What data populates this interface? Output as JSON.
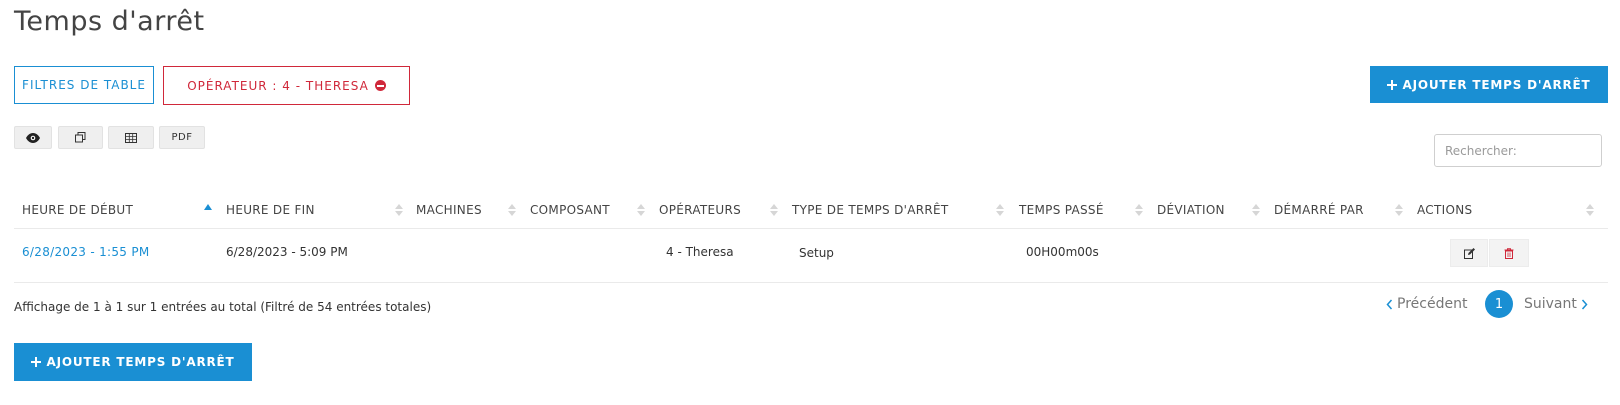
{
  "page": {
    "title": "Temps d'arrêt"
  },
  "filters": {
    "table_filters_label": "FILTRES DE TABLE",
    "active_filter_label": "OPÉRATEUR : 4 - THERESA"
  },
  "actions": {
    "add_label": "AJOUTER TEMPS D'ARRÊT"
  },
  "toolbar": {
    "pdf_label": "PDF"
  },
  "search": {
    "placeholder": "Rechercher:"
  },
  "table": {
    "columns": [
      "HEURE DE DÉBUT",
      "HEURE DE FIN",
      "MACHINES",
      "COMPOSANT",
      "OPÉRATEURS",
      "TYPE DE TEMPS D'ARRÊT",
      "TEMPS PASSÉ",
      "DÉVIATION",
      "DÉMARRÉ PAR",
      "ACTIONS"
    ],
    "sorted_column": "HEURE DE DÉBUT",
    "rows": [
      {
        "start": "6/28/2023 - 1:55 PM",
        "end": "6/28/2023 - 5:09 PM",
        "machines": "",
        "component": "",
        "operators": "4 - Theresa",
        "type": "Setup",
        "time_spent": "00H00m00s",
        "deviation": "",
        "started_by": ""
      }
    ]
  },
  "footer": {
    "info": "Affichage de 1 à 1 sur 1 entrées au total (Filtré de 54 entrées totales)"
  },
  "pagination": {
    "prev_label": "Précédent",
    "current_page": "1",
    "next_label": "Suivant"
  },
  "colors": {
    "primary": "#1a8fd3",
    "danger": "#d0283a"
  },
  "icons": [
    "plus-icon",
    "minus-circle-icon",
    "eye-icon",
    "copy-icon",
    "table-icon",
    "edit-icon",
    "trash-icon",
    "chevron-left-icon",
    "chevron-right-icon",
    "sort-asc-icon",
    "sort-icon"
  ]
}
